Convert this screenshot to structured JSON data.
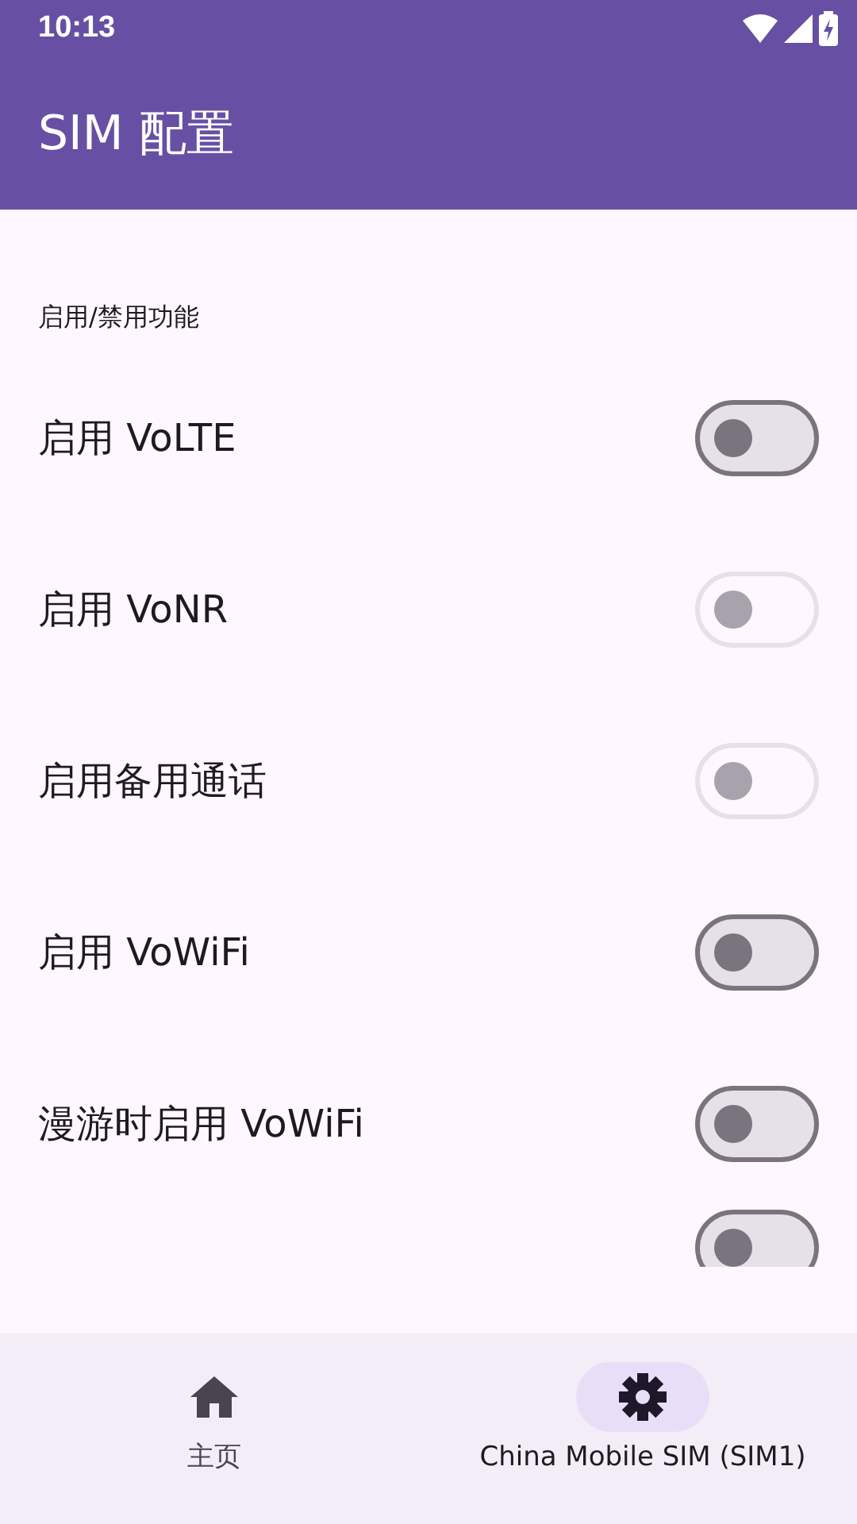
{
  "status_bar": {
    "time": "10:13"
  },
  "app_bar": {
    "title": "SIM 配置"
  },
  "section": {
    "title": "启用/禁用功能"
  },
  "settings": [
    {
      "label": "启用 VoLTE",
      "on": false,
      "disabled": false
    },
    {
      "label": "启用 VoNR",
      "on": false,
      "disabled": true
    },
    {
      "label": "启用备用通话",
      "on": false,
      "disabled": true
    },
    {
      "label": "启用 VoWiFi",
      "on": false,
      "disabled": false
    },
    {
      "label": "漫游时启用 VoWiFi",
      "on": false,
      "disabled": false
    },
    {
      "on": false,
      "disabled": false
    }
  ],
  "bottom_nav": [
    {
      "kind": "home",
      "label": "主页",
      "selected": false
    },
    {
      "kind": "settings",
      "label": "China Mobile SIM (SIM1)",
      "selected": true
    }
  ]
}
